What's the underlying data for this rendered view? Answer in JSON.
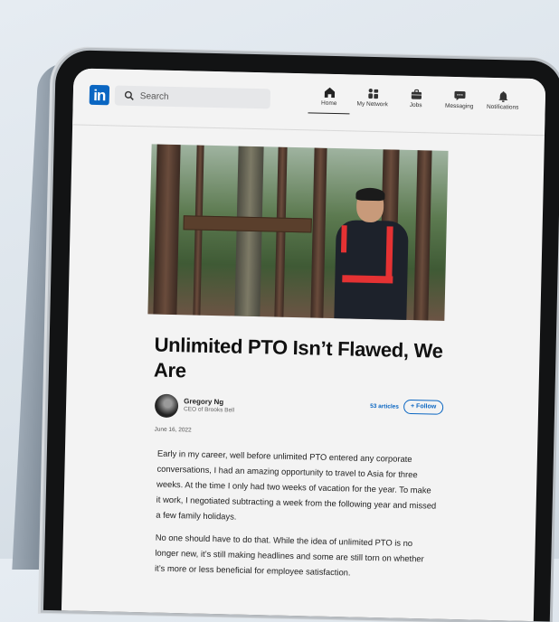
{
  "navbar": {
    "logo_text": "in",
    "search_placeholder": "Search",
    "items": [
      {
        "label": "Home",
        "icon": "home-icon",
        "active": true
      },
      {
        "label": "My Network",
        "icon": "network-icon"
      },
      {
        "label": "Jobs",
        "icon": "briefcase-icon"
      },
      {
        "label": "Messaging",
        "icon": "message-icon"
      },
      {
        "label": "Notifications",
        "icon": "bell-icon"
      }
    ]
  },
  "article": {
    "title": "Unlimited PTO Isn’t Flawed, We Are",
    "author": {
      "name": "Gregory Ng",
      "role": "CEO of Brooks Bell",
      "articles": "53 articles",
      "follow_label": "+ Follow"
    },
    "date": "June 16, 2022",
    "paragraphs": [
      "Early in my career, well before unlimited PTO entered any corporate conversations, I had an amazing opportunity to travel to Asia for three weeks. At the time I only had two weeks of vacation for the year. To make it work, I negotiated subtracting a week from the following year and missed a few family holidays.",
      "No one should have to do that. While the idea of unlimited PTO is no longer new, it’s still making headlines and some are still torn on whether it’s more or less beneficial for employee satisfaction."
    ]
  },
  "colors": {
    "brand": "#0a66c2"
  }
}
